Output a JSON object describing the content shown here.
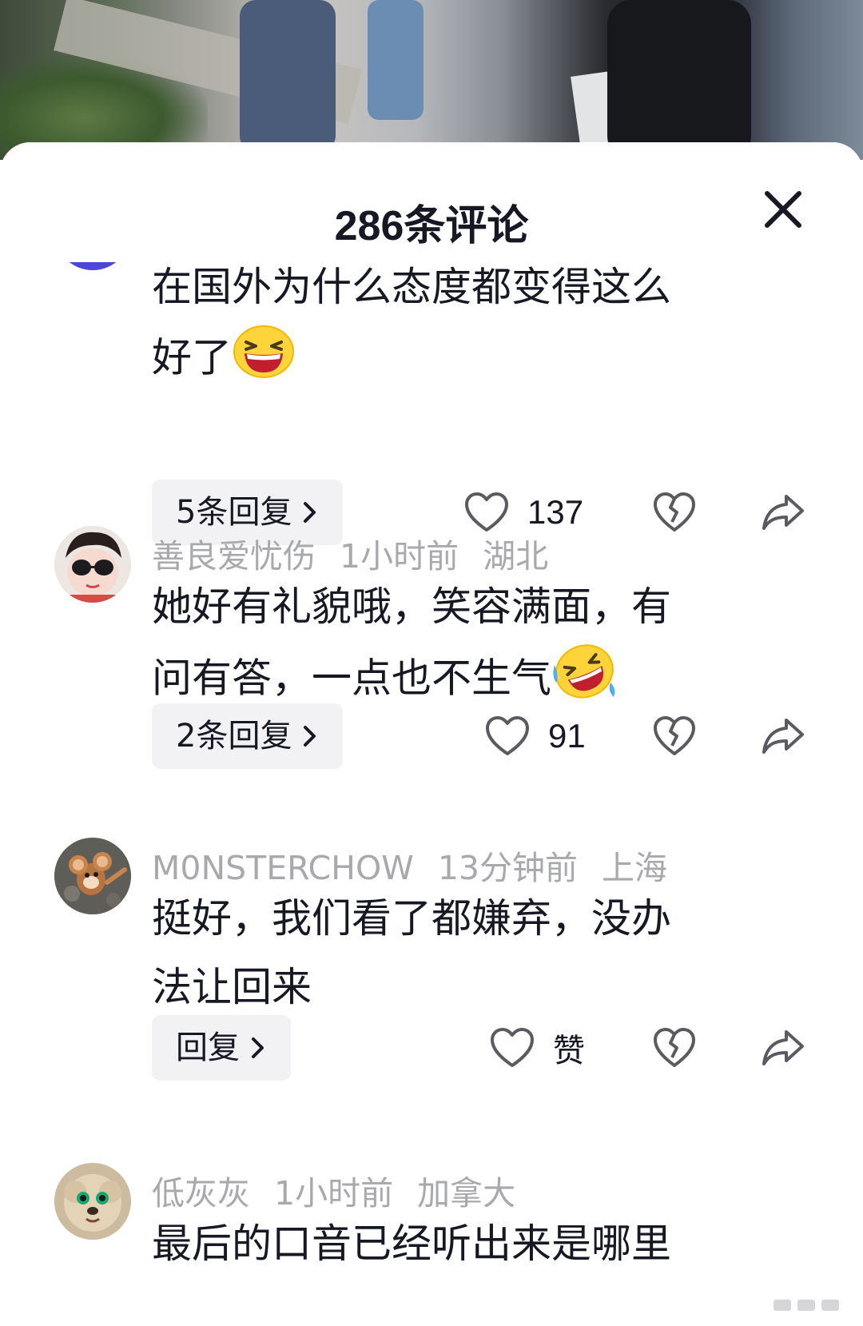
{
  "video": {
    "description_icon": "video-frame"
  },
  "sheet": {
    "title": "286条评论",
    "close_icon": "close-icon"
  },
  "comments": [
    {
      "user": "",
      "time": "",
      "location": "",
      "text_line1": "在国外为什么态度都变得这么",
      "text_line2": "好了",
      "emoji": "laughing-face",
      "reply_label": "5条回复",
      "likes": "137"
    },
    {
      "user": "善良爱忧伤",
      "time": "1小时前",
      "location": "湖北",
      "text_line1": "她好有礼貌哦，笑容满面，有",
      "text_line2": "问有答，一点也不生气",
      "emoji": "rolling-laughing-face",
      "reply_label": "2条回复",
      "likes": "91"
    },
    {
      "user": "M0NSTERCHOW",
      "time": "13分钟前",
      "location": "上海",
      "text_line1": "挺好，我们看了都嫌弃，没办",
      "text_line2": "法让回来",
      "emoji": "",
      "reply_label": "回复",
      "likes": "赞"
    },
    {
      "user": "低灰灰",
      "time": "1小时前",
      "location": "加拿大",
      "text_line1": "最后的口音已经听出来是哪里",
      "text_line2": "",
      "emoji": "",
      "reply_label": "",
      "likes": ""
    }
  ],
  "colors": {
    "text": "#161823",
    "meta": "#a8a9ad",
    "pill": "#f2f2f4",
    "icon": "#5a5b61"
  }
}
